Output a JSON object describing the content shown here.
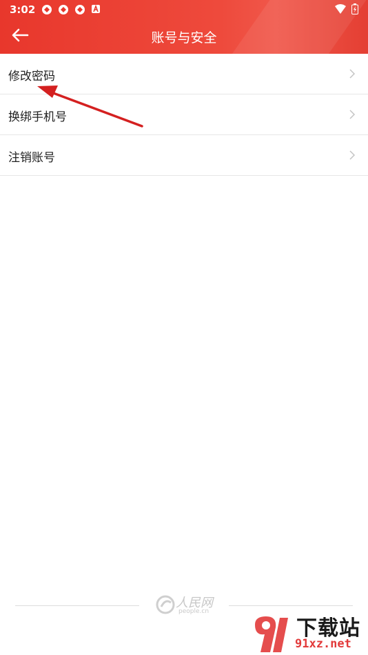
{
  "status_bar": {
    "time": "3:02"
  },
  "header": {
    "title": "账号与安全"
  },
  "menu": {
    "items": [
      {
        "label": "修改密码"
      },
      {
        "label": "换绑手机号"
      },
      {
        "label": "注销账号"
      }
    ]
  },
  "footer": {
    "logo_text": "人民网",
    "logo_sub": "people.cn"
  },
  "watermark": {
    "text": "下载站",
    "url": "91xz.net"
  },
  "colors": {
    "header": "#e8372c",
    "annotation_arrow": "#d42020"
  }
}
